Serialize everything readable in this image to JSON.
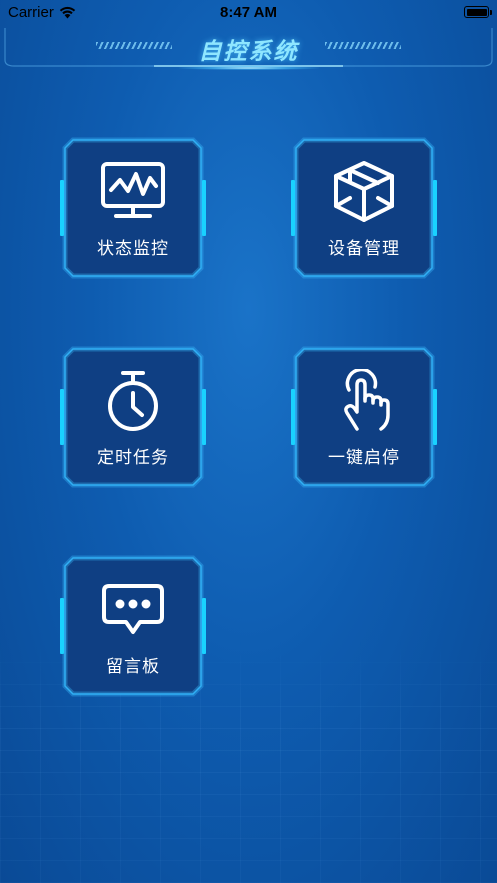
{
  "status_bar": {
    "carrier": "Carrier",
    "time": "8:47 AM"
  },
  "header": {
    "title": "自控系统"
  },
  "theme": {
    "background": "#0e5cb0",
    "accent": "#19d2ff",
    "tile_fill": "#0f3f83",
    "title_color": "#8ee6ff"
  },
  "tiles": [
    {
      "label": "状态监控",
      "icon": "monitor-chart-icon"
    },
    {
      "label": "设备管理",
      "icon": "cube-icon"
    },
    {
      "label": "定时任务",
      "icon": "stopwatch-icon"
    },
    {
      "label": "一键启停",
      "icon": "tap-hand-icon"
    },
    {
      "label": "留言板",
      "icon": "message-bubble-icon"
    }
  ]
}
